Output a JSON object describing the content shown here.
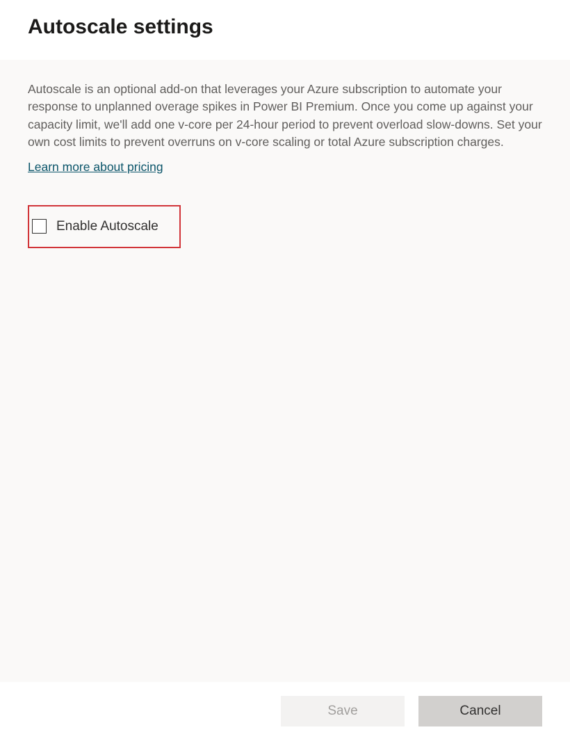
{
  "header": {
    "title": "Autoscale settings"
  },
  "main": {
    "description": "Autoscale is an optional add-on that leverages your Azure subscription to automate your response to unplanned overage spikes in Power BI Premium. Once you come up against your capacity limit, we'll add one v-core per 24-hour period to prevent overload slow-downs. Set your own cost limits to prevent overruns on v-core scaling or total Azure subscription charges.",
    "learn_more_label": "Learn more about pricing",
    "checkbox_label": "Enable Autoscale"
  },
  "footer": {
    "save_label": "Save",
    "cancel_label": "Cancel"
  }
}
